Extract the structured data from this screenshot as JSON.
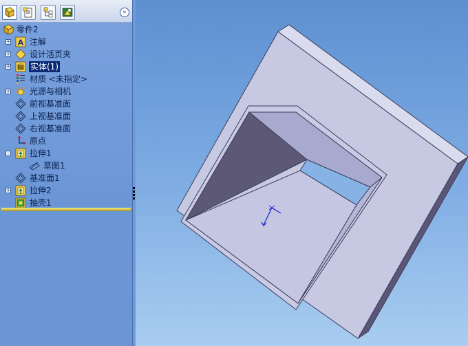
{
  "feature_tree": {
    "items": [
      {
        "id": "part",
        "label": "零件2",
        "icon": "part-icon",
        "expand": "",
        "level": 0
      },
      {
        "id": "annot",
        "label": "注解",
        "icon": "annotation-icon",
        "expand": "+",
        "level": 1
      },
      {
        "id": "design",
        "label": "设计活页夹",
        "icon": "design-binder-icon",
        "expand": "+",
        "level": 1
      },
      {
        "id": "solid",
        "label": "实体(1)",
        "icon": "solid-bodies-icon",
        "expand": "+",
        "level": 1,
        "selected": true
      },
      {
        "id": "mat",
        "label": "材质 <未指定>",
        "icon": "material-icon",
        "expand": "",
        "level": 1
      },
      {
        "id": "light",
        "label": "光源与相机",
        "icon": "lights-camera-icon",
        "expand": "+",
        "level": 1
      },
      {
        "id": "front",
        "label": "前视基准面",
        "icon": "plane-icon",
        "expand": "",
        "level": 1
      },
      {
        "id": "top",
        "label": "上视基准面",
        "icon": "plane-icon",
        "expand": "",
        "level": 1
      },
      {
        "id": "right",
        "label": "右视基准面",
        "icon": "plane-icon",
        "expand": "",
        "level": 1
      },
      {
        "id": "origin",
        "label": "原点",
        "icon": "origin-icon",
        "expand": "",
        "level": 1
      },
      {
        "id": "ext1",
        "label": "拉伸1",
        "icon": "extrude-icon",
        "expand": "-",
        "level": 1
      },
      {
        "id": "sketch",
        "label": "草图1",
        "icon": "sketch-icon",
        "expand": "",
        "level": 2
      },
      {
        "id": "plane1",
        "label": "基准面1",
        "icon": "plane-icon",
        "expand": "",
        "level": 1
      },
      {
        "id": "ext2",
        "label": "拉伸2",
        "icon": "extrude-icon",
        "expand": "+",
        "level": 1
      },
      {
        "id": "shell",
        "label": "抽壳1",
        "icon": "shell-icon",
        "expand": "",
        "level": 1
      }
    ]
  },
  "panel_tabs": [
    {
      "id": "featuremanager",
      "icon": "feature-manager-icon",
      "active": true
    },
    {
      "id": "propertymanager",
      "icon": "property-manager-icon",
      "active": false
    },
    {
      "id": "configmanager",
      "icon": "configuration-manager-icon",
      "active": false
    },
    {
      "id": "dimxpert",
      "icon": "display-manager-icon",
      "active": false
    }
  ],
  "expand_glyph": "»",
  "colors": {
    "panel_bg": "#6b96d6",
    "selection": "#0a2a74",
    "rollback_bar": "#d8c84a",
    "model_face_light": "#c4c6e2",
    "model_face_dark": "#5c5876",
    "origin_marker": "#1f2fd0"
  }
}
